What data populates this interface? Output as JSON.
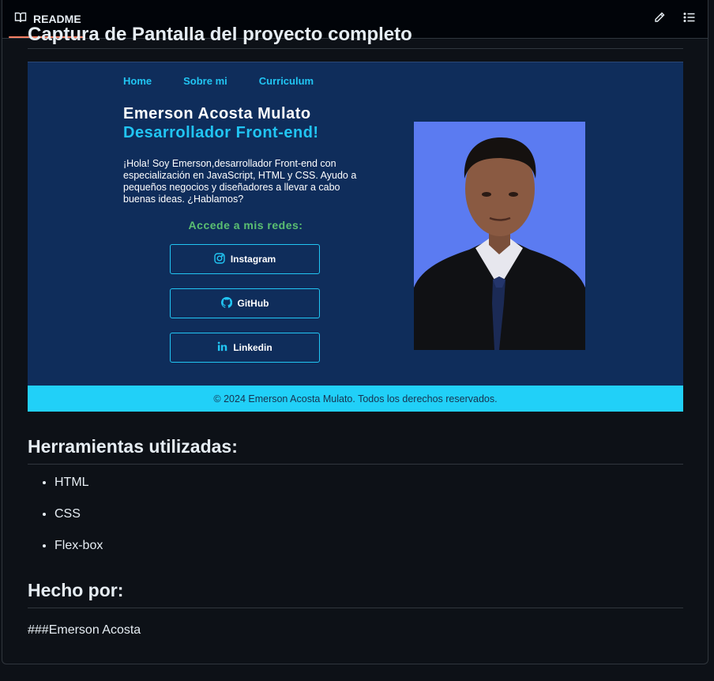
{
  "tab": {
    "label": "README",
    "icon": "book-icon"
  },
  "toolbar": {
    "edit_icon": "pencil-icon",
    "outline_icon": "list-icon"
  },
  "cut_heading": "Captura de Pantalla del proyecto completo",
  "preview": {
    "nav": [
      "Home",
      "Sobre mi",
      "Curriculum"
    ],
    "name": "Emerson Acosta Mulato",
    "role": "Desarrollador Front-end!",
    "intro": "¡Hola! Soy Emerson,desarrollador Front-end con especialización en JavaScript, HTML y CSS. Ayudo a pequeños negocios y diseñadores a llevar a cabo buenas ideas. ¿Hablamos?",
    "social_title": "Accede a mis redes:",
    "buttons": [
      "Instagram",
      "GitHub",
      "Linkedin"
    ],
    "footer": "© 2024 Emerson Acosta Mulato. Todos los derechos reservados.",
    "colors": {
      "background": "#0f2d5b",
      "accent": "#21c5f3",
      "green": "#5bbf71",
      "footer": "#21d0f8",
      "photo_bg": "#5b7bf1"
    }
  },
  "tools": {
    "heading": "Herramientas utilizadas:",
    "items": [
      "HTML",
      "CSS",
      "Flex-box"
    ]
  },
  "made_by": {
    "heading": "Hecho por:",
    "text": "###Emerson Acosta"
  }
}
